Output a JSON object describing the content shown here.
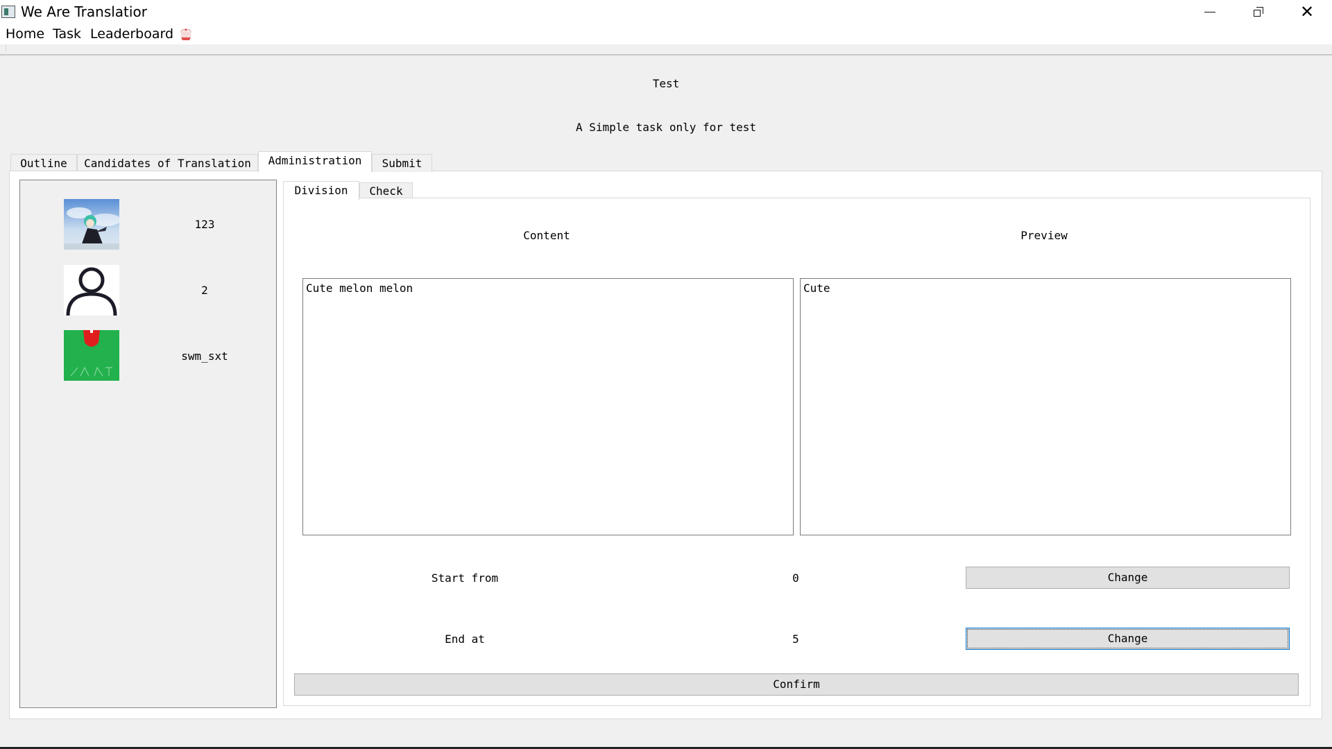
{
  "window": {
    "title": "We Are Translatior"
  },
  "menu": {
    "items": [
      "Home",
      "Task",
      "Leaderboard"
    ],
    "extra_icon": "cake-icon"
  },
  "task": {
    "title": "Test",
    "description": "A Simple task only for test"
  },
  "tabs": {
    "items": [
      "Outline",
      "Candidates of Translation",
      "Administration",
      "Submit"
    ],
    "active": "Administration"
  },
  "users": [
    {
      "name": "123",
      "avatar": "anime-avatar"
    },
    {
      "name": "2",
      "avatar": "default-person-icon"
    },
    {
      "name": "swm_sxt",
      "avatar": "green-avatar"
    }
  ],
  "admin_tabs": {
    "items": [
      "Division",
      "Check"
    ],
    "active": "Division"
  },
  "division": {
    "content_label": "Content",
    "preview_label": "Preview",
    "content_text": "Cute melon melon",
    "preview_text": "Cute",
    "start_label": "Start from",
    "start_value": "0",
    "end_label": "End at",
    "end_value": "5",
    "change_label": "Change",
    "confirm_label": "Confirm"
  },
  "colors": {
    "window_bg": "#f0f0f0",
    "avatar_green": "#22b14c",
    "avatar_red": "#e01e1e",
    "focus_border": "#0078d7"
  }
}
